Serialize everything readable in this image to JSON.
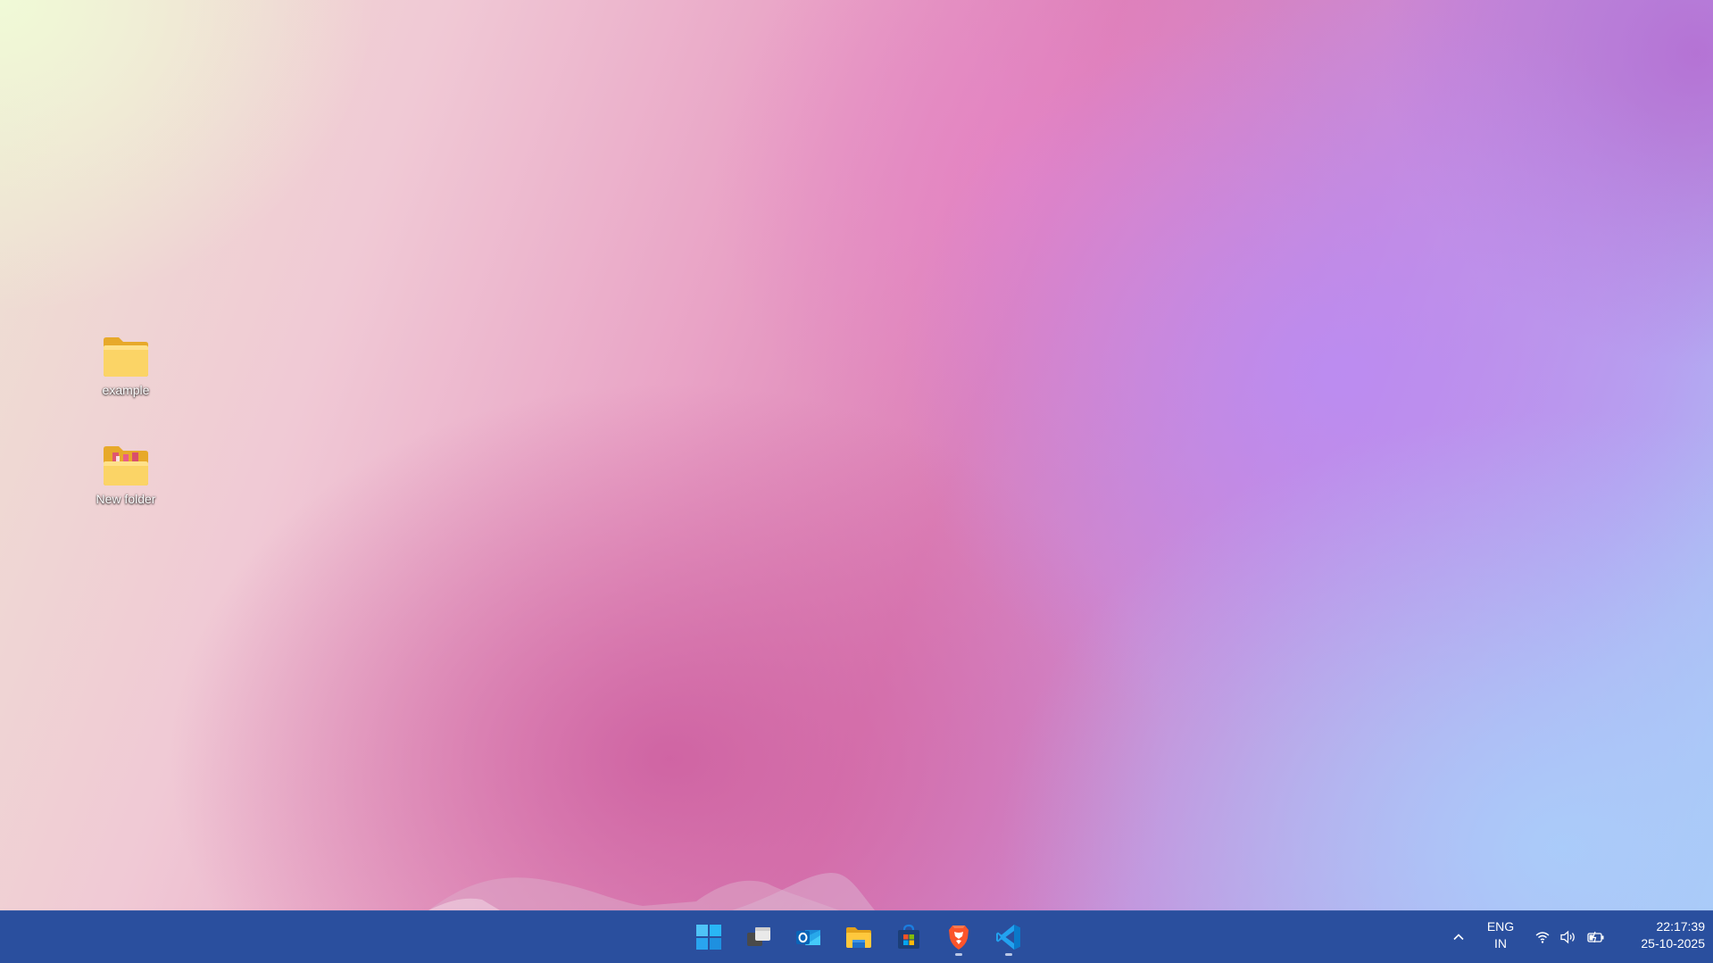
{
  "desktop": {
    "icons": [
      {
        "label": "example",
        "icon": "folder-icon"
      },
      {
        "label": "New folder",
        "icon": "folder-with-files-icon"
      }
    ]
  },
  "taskbar": {
    "apps": [
      {
        "name": "Start",
        "icon": "windows-start-icon",
        "running": false
      },
      {
        "name": "Task View",
        "icon": "task-view-icon",
        "running": false
      },
      {
        "name": "Outlook",
        "icon": "outlook-icon",
        "running": false
      },
      {
        "name": "File Explorer",
        "icon": "file-explorer-icon",
        "running": false
      },
      {
        "name": "Microsoft Store",
        "icon": "microsoft-store-icon",
        "running": false
      },
      {
        "name": "Brave",
        "icon": "brave-browser-icon",
        "running": true
      },
      {
        "name": "Visual Studio Code",
        "icon": "vscode-icon",
        "running": true
      }
    ],
    "tray": {
      "language_line1": "ENG",
      "language_line2": "IN",
      "icons": [
        "show-hidden-icons-chevron",
        "wifi-icon",
        "volume-icon",
        "battery-charging-icon"
      ]
    },
    "clock": {
      "time": "22:17:39",
      "date": "25-10-2025"
    }
  },
  "colors": {
    "taskbar": "#2a4f9e",
    "folder": "#f6c94c",
    "brave": "#fb542b",
    "vscode": "#22a2ef"
  }
}
